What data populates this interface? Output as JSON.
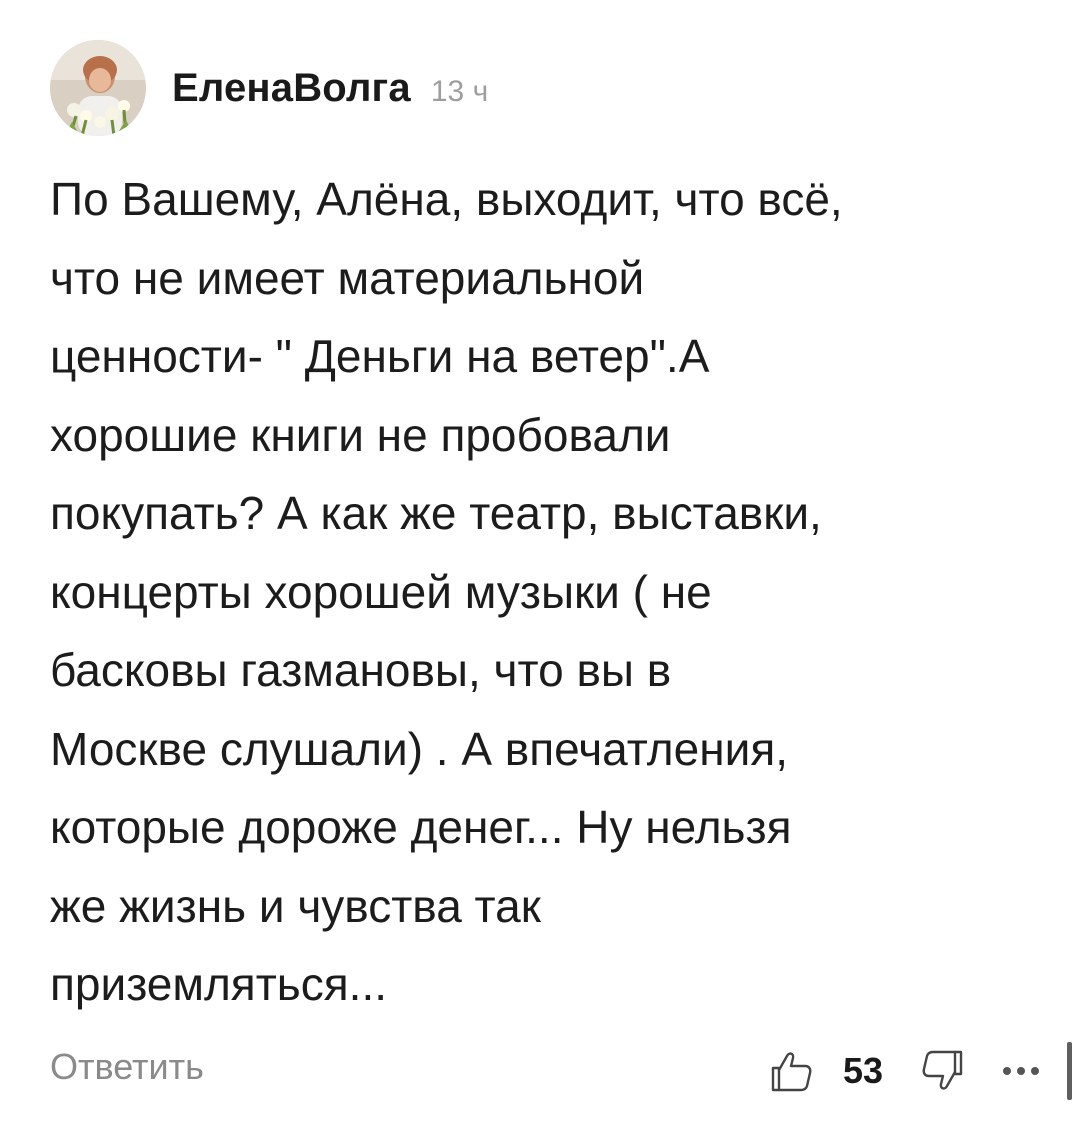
{
  "comment": {
    "author": "ЕленаВолга",
    "time": "13 ч",
    "text": "По Вашему, Алёна, выходит, что всё,\nчто не имеет материальной\nценности- \" Деньги на ветер\".А\nхорошие книги не пробовали\nпокупать? А как же театр, выставки,\nконцерты хорошей музыки ( не\nбасковы газмановы, что вы в\nМоскве слушали) . А впечатления,\nкоторые дороже денег... Ну нельзя\nже жизнь и чувства так\nприземляться...",
    "reply_label": "Ответить",
    "like_count": "53"
  },
  "icons": {
    "like": "thumbs-up-icon",
    "dislike": "thumbs-down-icon",
    "more": "more-dots-icon"
  },
  "colors": {
    "text": "#1c1c1c",
    "muted": "#9e9e9e",
    "reply": "#8a8a8a"
  }
}
